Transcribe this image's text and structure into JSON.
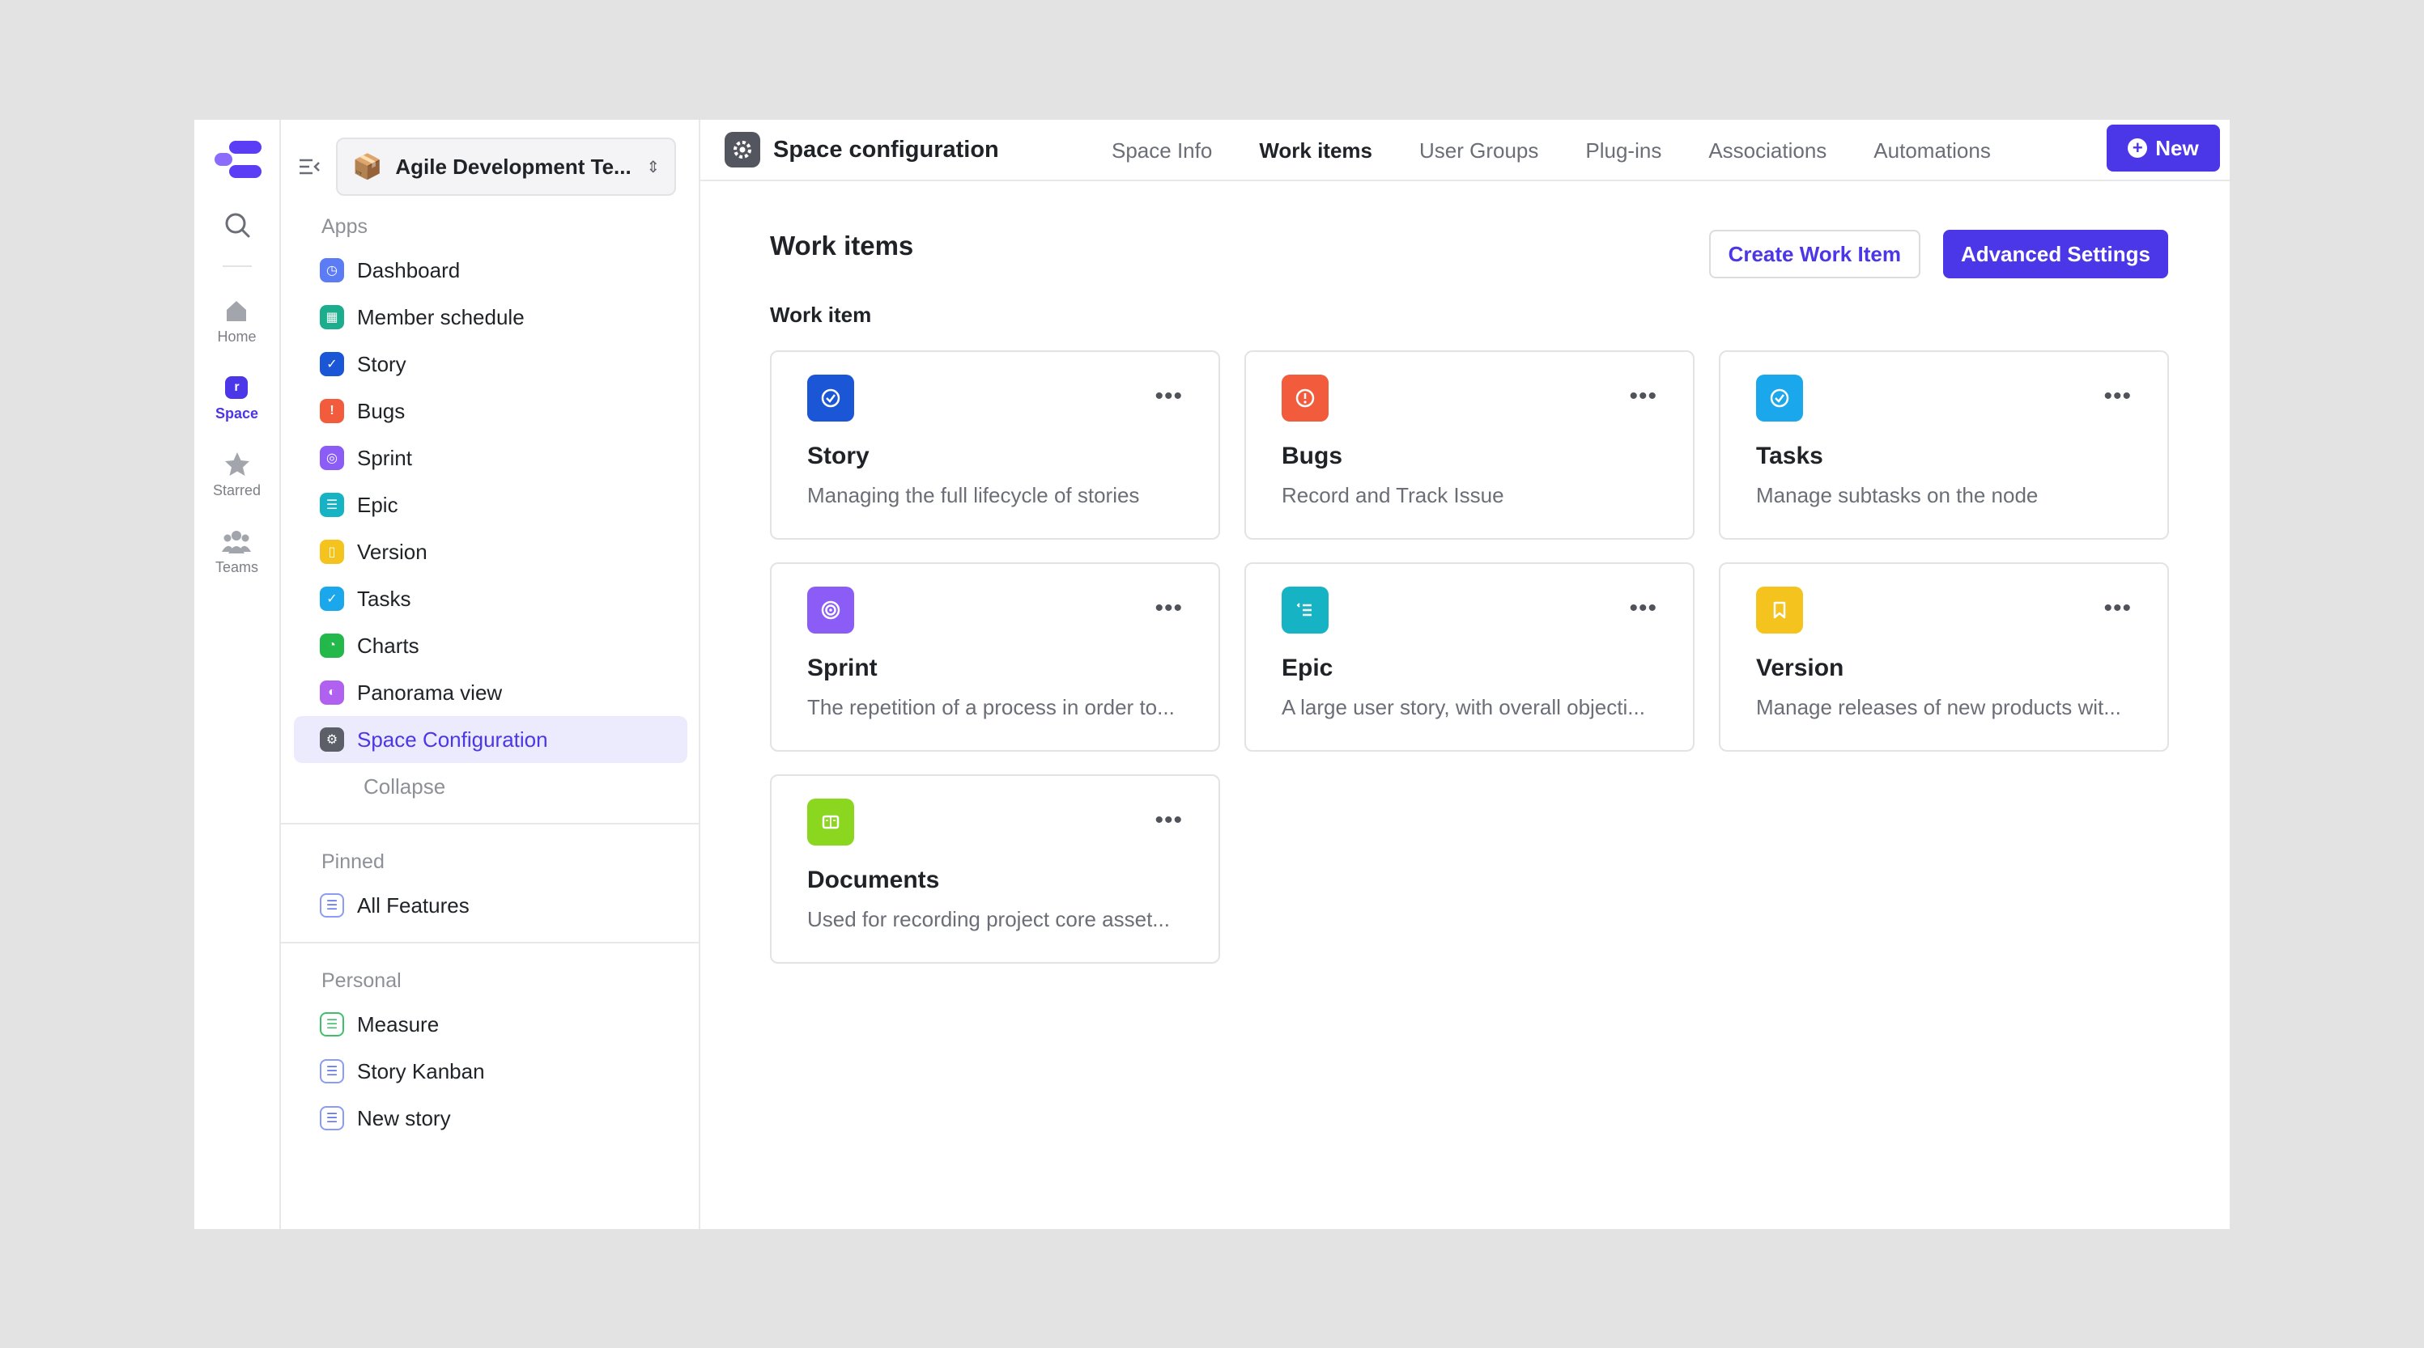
{
  "rail": {
    "items": [
      {
        "label": "Home",
        "icon": "home-icon"
      },
      {
        "label": "Space",
        "icon": "space-icon"
      },
      {
        "label": "Starred",
        "icon": "star-icon"
      },
      {
        "label": "Teams",
        "icon": "teams-icon"
      }
    ]
  },
  "sidebar": {
    "space_name": "Agile Development Te...",
    "apps_title": "Apps",
    "apps": [
      {
        "label": "Dashboard",
        "color": "#5b7cf5"
      },
      {
        "label": "Member schedule",
        "color": "#1cae8c"
      },
      {
        "label": "Story",
        "color": "#1a56d6"
      },
      {
        "label": "Bugs",
        "color": "#f25c3c"
      },
      {
        "label": "Sprint",
        "color": "#8b5cf6"
      },
      {
        "label": "Epic",
        "color": "#16b3c4"
      },
      {
        "label": "Version",
        "color": "#f5c31e"
      },
      {
        "label": "Tasks",
        "color": "#1aa7ec"
      },
      {
        "label": "Charts",
        "color": "#22b84a"
      },
      {
        "label": "Panorama view",
        "color": "#b061f0"
      },
      {
        "label": "Space Configuration",
        "color": "#5c5f67"
      }
    ],
    "collapse_label": "Collapse",
    "pinned_title": "Pinned",
    "pinned": [
      {
        "label": "All Features"
      }
    ],
    "personal_title": "Personal",
    "personal": [
      {
        "label": "Measure"
      },
      {
        "label": "Story Kanban"
      },
      {
        "label": "New story"
      }
    ]
  },
  "topbar": {
    "title": "Space configuration",
    "tabs": [
      "Space Info",
      "Work items",
      "User Groups",
      "Plug-ins",
      "Associations",
      "Automations"
    ],
    "new_label": "New"
  },
  "content": {
    "title": "Work items",
    "create_label": "Create Work Item",
    "advanced_label": "Advanced Settings",
    "section_label": "Work item",
    "cards": [
      {
        "title": "Story",
        "desc": "Managing the full lifecycle of stories",
        "color": "#1a56d6"
      },
      {
        "title": "Bugs",
        "desc": "Record and Track Issue",
        "color": "#f25c3c"
      },
      {
        "title": "Tasks",
        "desc": "Manage subtasks on the node",
        "color": "#1aa7ec"
      },
      {
        "title": "Sprint",
        "desc": "The repetition of a process in order to...",
        "color": "#8b5cf6"
      },
      {
        "title": "Epic",
        "desc": "A large user story, with overall objecti...",
        "color": "#16b3c4"
      },
      {
        "title": "Version",
        "desc": "Manage releases of new products wit...",
        "color": "#f5c31e"
      },
      {
        "title": "Documents",
        "desc": "Used for recording project core asset...",
        "color": "#8bd61f"
      }
    ]
  }
}
